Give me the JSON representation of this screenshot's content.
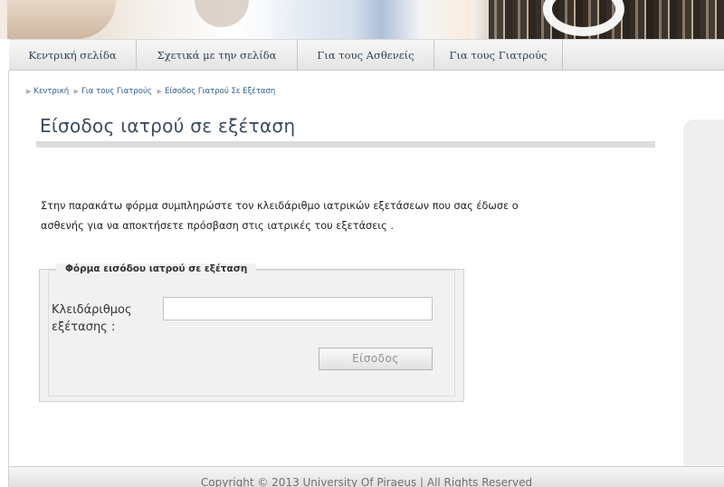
{
  "nav": {
    "items": [
      {
        "label": "Κεντρική σελίδα"
      },
      {
        "label": "Σχετικά με την σελίδα"
      },
      {
        "label": "Για τους Ασθενείς"
      },
      {
        "label": "Για τους Γιατρούς"
      }
    ]
  },
  "breadcrumb": {
    "items": [
      "Κεντρική",
      "Για τους Γιατρούς",
      "Είσοδος Γιατρού Σε Εξέταση"
    ]
  },
  "page": {
    "title": "Είσοδος ιατρού σε εξέταση",
    "intro_line1": "Στην παρακάτω φόρμα συμπληρώστε τον κλειδάριθμο ιατρικών εξετάσεων που σας έδωσε ο",
    "intro_line2": "ασθενής για να αποκτήσετε πρόσβαση στις ιατρικές του εξετάσεις ."
  },
  "form": {
    "legend": "Φόρμα εισόδου ιατρού σε εξέταση",
    "field_label_line1": "Κλειδάριθμος",
    "field_label_line2": "εξέτασης :",
    "field_value": "",
    "submit_label": "Είσοδος"
  },
  "footer": {
    "copyright": "Copyright © 2013 University Of Piraeus  |  All Rights Reserved"
  }
}
